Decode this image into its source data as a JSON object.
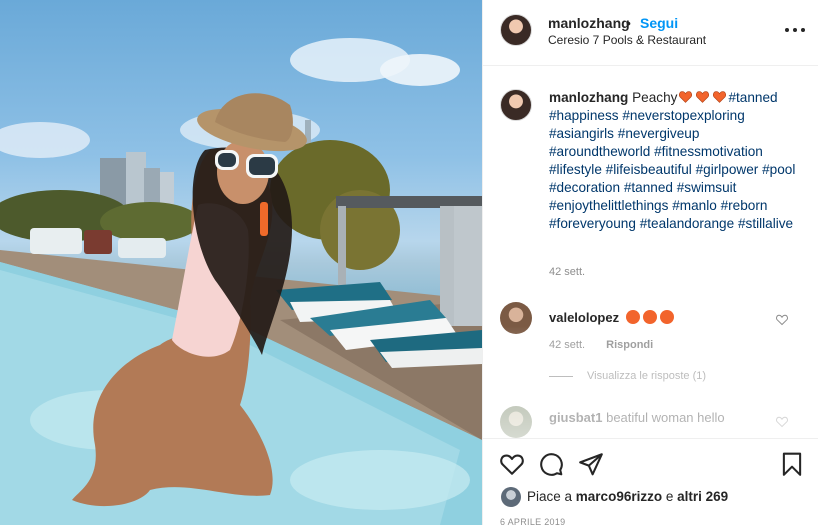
{
  "post": {
    "photo_alt": "",
    "author": "manlozhang",
    "separator": "•",
    "follow_label": "Segui",
    "location": "Ceresio 7 Pools & Restaurant"
  },
  "caption": {
    "username": "manlozhang",
    "text_before_emoji": "Peachy",
    "emoji": "orange-heart-icon",
    "tags_first": "#tanned",
    "hashtags": [
      "#happiness",
      "#neverstopexploring",
      "#asiangirls",
      "#nevergiveup",
      "#aroundtheworld",
      "#fitnessmotivation",
      "#lifestyle",
      "#lifeisbeautiful",
      "#girlpower",
      "#pool",
      "#decoration",
      "#tanned",
      "#swimsuit",
      "#enjoythelittlethings",
      "#manlo",
      "#reborn",
      "#foreveryoung",
      "#tealandorange",
      "#stillalive"
    ],
    "time": "42 sett."
  },
  "comments": [
    {
      "username": "valelolopez",
      "emoji": "heart-eyes-icon",
      "time": "42 sett.",
      "reply_label": "Rispondi",
      "view_replies": "Visualizza le risposte (1)"
    },
    {
      "username": "giusbat1",
      "text": "beatiful woman hello"
    }
  ],
  "actions": {
    "likes_prefix": "Piace a",
    "likes_user": "marco96rizzo",
    "likes_join": "e",
    "likes_others": "altri 269",
    "date": "6 APRILE 2019"
  },
  "colors": {
    "link": "#0095f6",
    "hashtag": "#00376b",
    "heart": "#f2642c",
    "muted": "#8e8e8e"
  }
}
